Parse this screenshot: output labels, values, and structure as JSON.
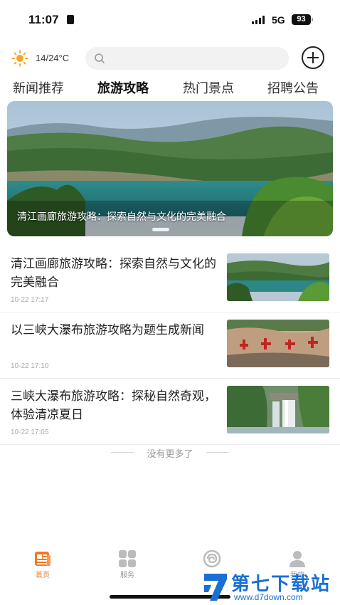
{
  "status_bar": {
    "time": "11:07",
    "network": "5G",
    "battery": "93"
  },
  "header": {
    "weather_icon": "sun-icon",
    "weather_text": "14/24°C",
    "search_placeholder": "",
    "search_icon": "search-icon",
    "add_icon": "plus-circle-icon"
  },
  "tabs": [
    {
      "label": "新闻推荐",
      "active": false
    },
    {
      "label": "旅游攻略",
      "active": true
    },
    {
      "label": "热门景点",
      "active": false
    },
    {
      "label": "招聘公告",
      "active": false
    }
  ],
  "banner": {
    "caption": "清江画廊旅游攻略：探索自然与文化的完美融合"
  },
  "news": [
    {
      "title": "清江画廊旅游攻略：探索自然与文化的完美融合",
      "time": "10-22 17:17",
      "thumb": "lake-landscape"
    },
    {
      "title": "以三峡大瀑布旅游攻略为题生成新闻",
      "time": "10-22 17:10",
      "thumb": "red-calligraphy-rock"
    },
    {
      "title": "三峡大瀑布旅游攻略：探秘自然奇观，体验清凉夏日",
      "time": "10-22 17:05",
      "thumb": "waterfall"
    }
  ],
  "list_end_text": "没有更多了",
  "bottom_nav": [
    {
      "label": "首页",
      "icon": "news-icon",
      "active": true
    },
    {
      "label": "服务",
      "icon": "grid-icon",
      "active": false
    },
    {
      "label": "",
      "icon": "swirl-icon",
      "active": false
    },
    {
      "label": "我的",
      "icon": "user-icon",
      "active": false
    }
  ],
  "watermark": {
    "brand": "第七下载站",
    "url": "www.d7down.com"
  },
  "colors": {
    "accent": "#f07a21",
    "watermark_blue": "#1a6fd4"
  }
}
